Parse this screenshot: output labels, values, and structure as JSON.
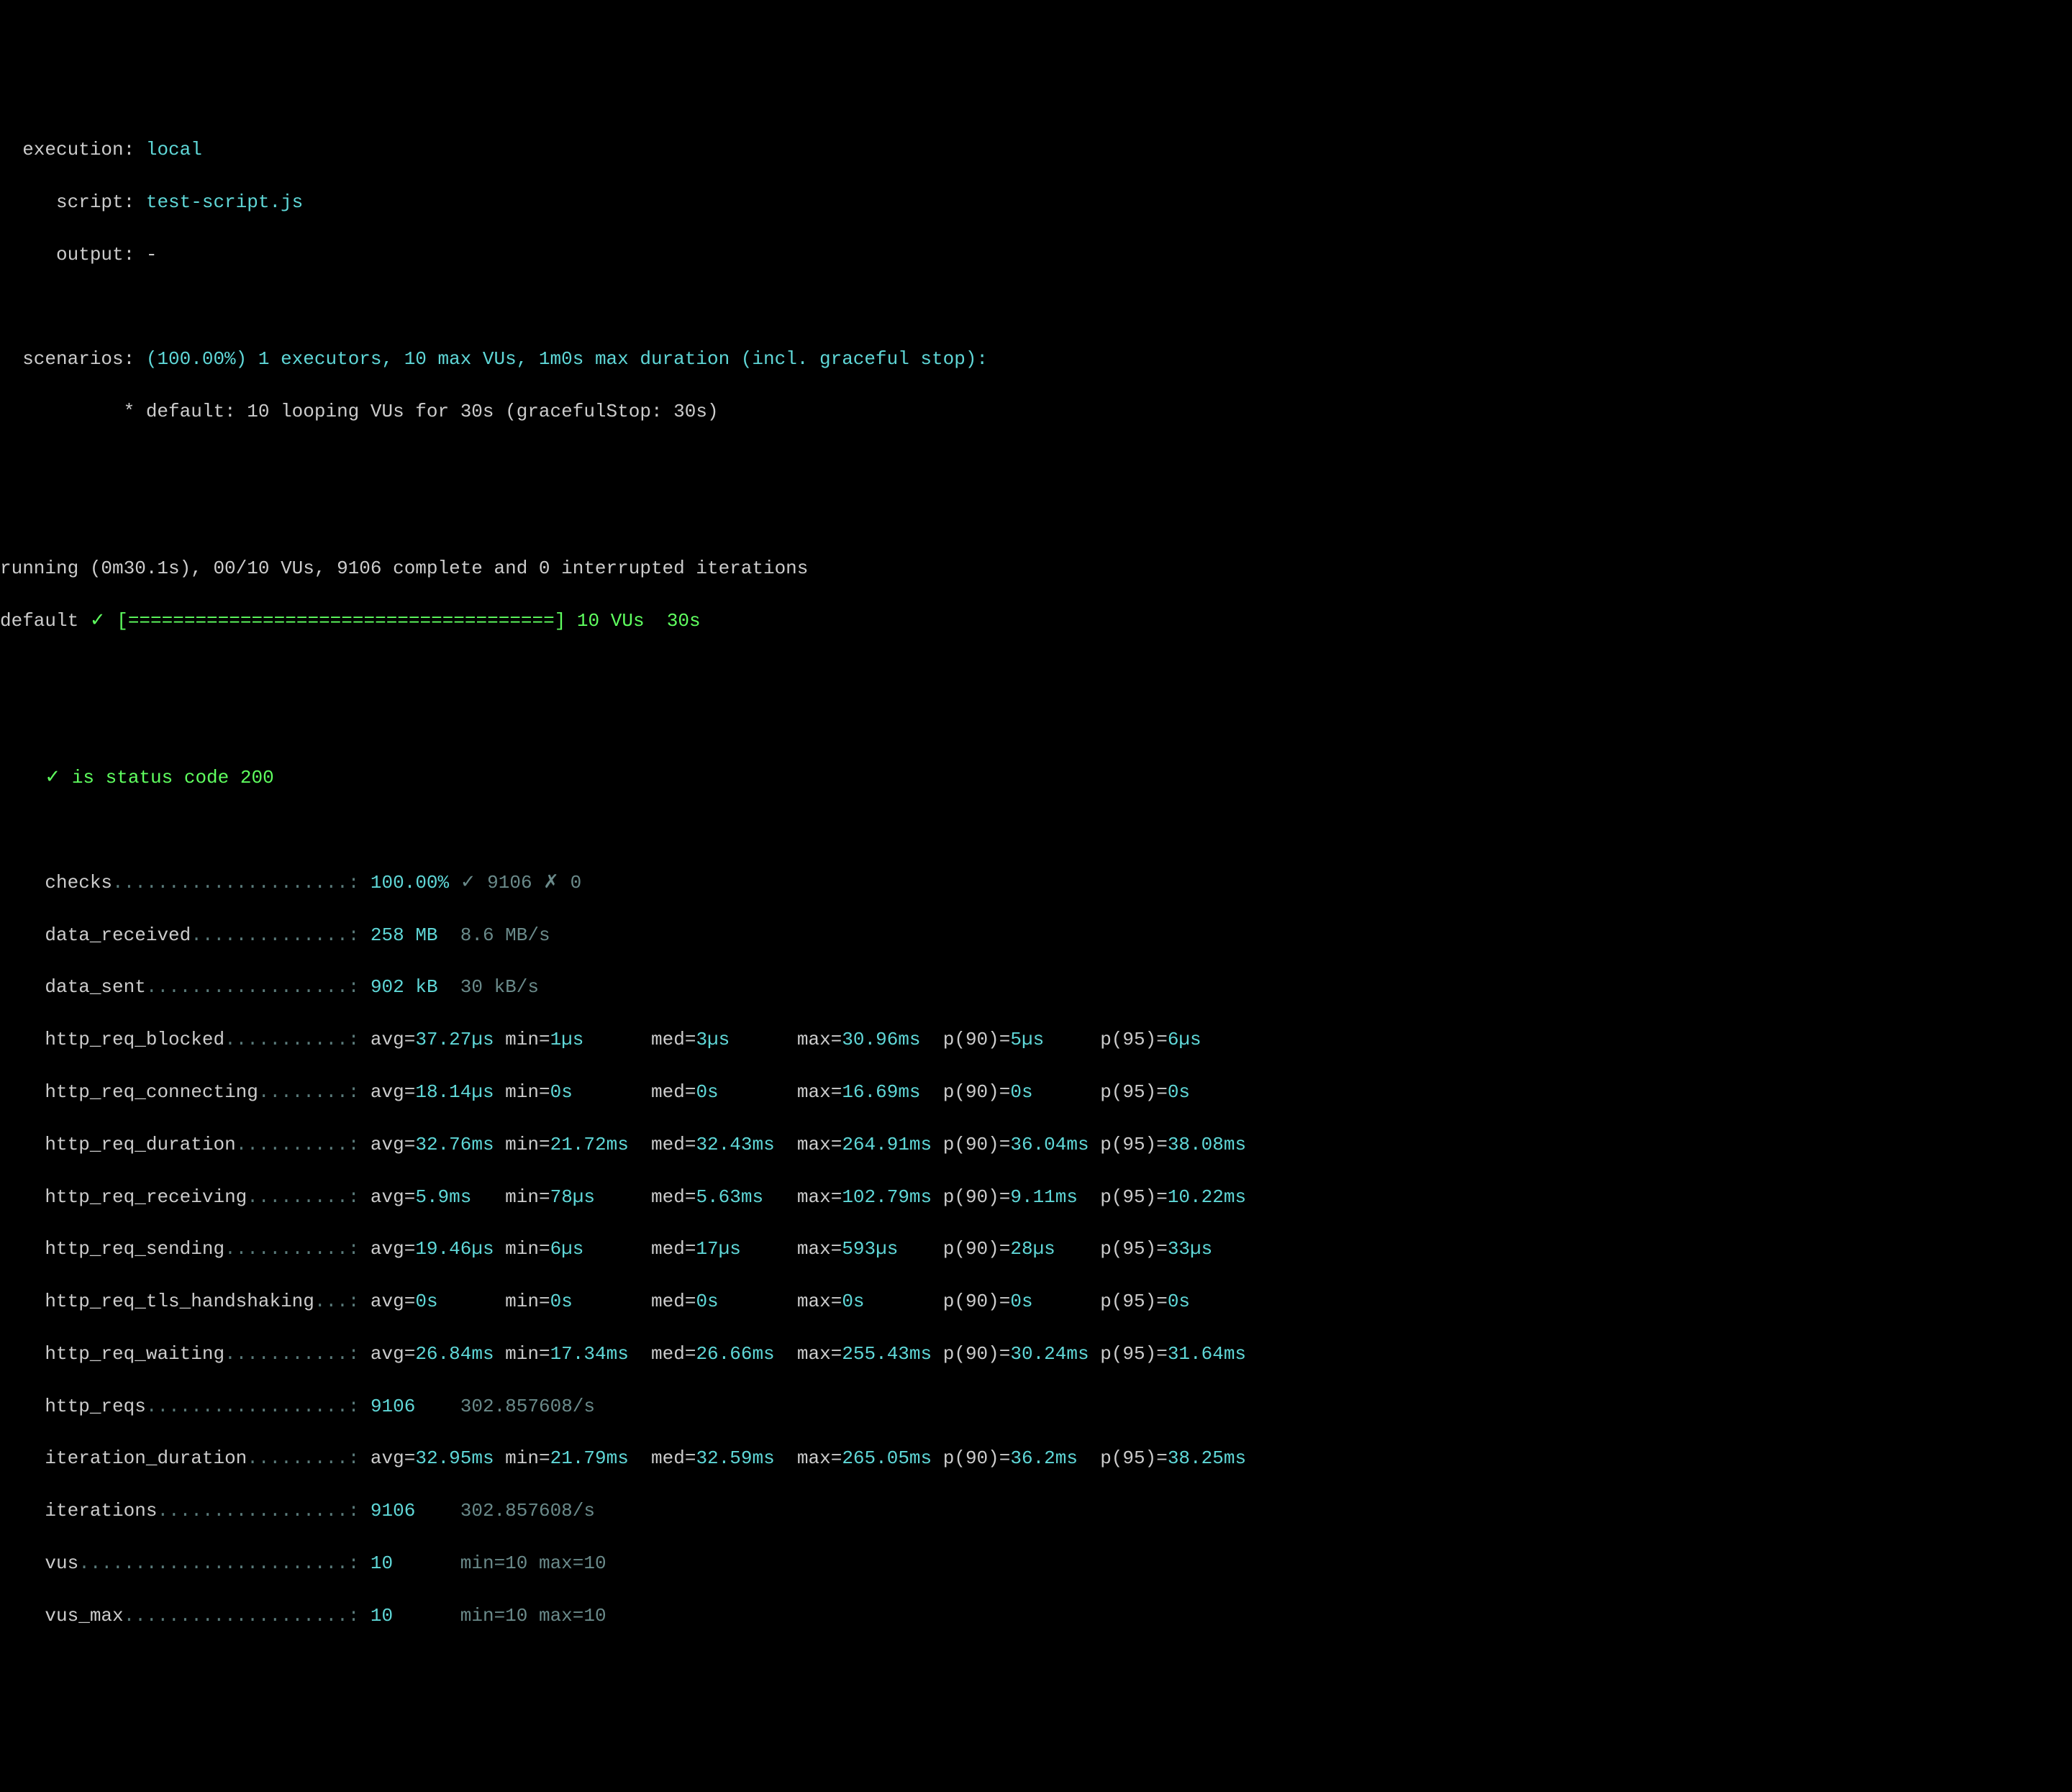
{
  "header": {
    "execution_label": "  execution: ",
    "execution_value": "local",
    "script_label": "     script: ",
    "script_value": "test-script.js",
    "output_label": "     output: ",
    "output_value": "-"
  },
  "scenarios": {
    "label": "  scenarios: ",
    "summary": "(100.00%) 1 executors, 10 max VUs, 1m0s max duration (incl. graceful stop):",
    "detail": "           * default: 10 looping VUs for 30s (gracefulStop: 30s)"
  },
  "running": {
    "line": "running (0m30.1s), 00/10 VUs, 9106 complete and 0 interrupted iterations",
    "default_prefix": "default ",
    "check_glyph": "✓",
    "bar": " [======================================] 10 VUs  30s"
  },
  "status_check": {
    "glyph": "✓",
    "text": " is status code 200"
  },
  "metrics": {
    "checks": {
      "name": "checks",
      "dots": ".....................",
      "value": "100.00%",
      "pass_glyph": "✓",
      "pass": " 9106 ",
      "fail_glyph": "✗",
      "fail": " 0"
    },
    "data_received": {
      "name": "data_received",
      "dots": "..............",
      "value": "258 MB",
      "rate": "  8.6 MB/s"
    },
    "data_sent": {
      "name": "data_sent",
      "dots": "..................",
      "value": "902 kB",
      "rate": "  30 kB/s"
    },
    "http_req_blocked": {
      "name": "http_req_blocked",
      "dots": "...........",
      "avg": "37.27µs",
      "min": "1µs",
      "med": "3µs",
      "max": "30.96ms",
      "p90": "5µs",
      "p95": "6µs"
    },
    "http_req_connecting": {
      "name": "http_req_connecting",
      "dots": "........",
      "avg": "18.14µs",
      "min": "0s",
      "med": "0s",
      "max": "16.69ms",
      "p90": "0s",
      "p95": "0s"
    },
    "http_req_duration": {
      "name": "http_req_duration",
      "dots": "..........",
      "avg": "32.76ms",
      "min": "21.72ms",
      "med": "32.43ms",
      "max": "264.91ms",
      "p90": "36.04ms",
      "p95": "38.08ms"
    },
    "http_req_receiving": {
      "name": "http_req_receiving",
      "dots": ".........",
      "avg": "5.9ms",
      "min": "78µs",
      "med": "5.63ms",
      "max": "102.79ms",
      "p90": "9.11ms",
      "p95": "10.22ms"
    },
    "http_req_sending": {
      "name": "http_req_sending",
      "dots": "...........",
      "avg": "19.46µs",
      "min": "6µs",
      "med": "17µs",
      "max": "593µs",
      "p90": "28µs",
      "p95": "33µs"
    },
    "http_req_tls_handshaking": {
      "name": "http_req_tls_handshaking",
      "dots": "...",
      "avg": "0s",
      "min": "0s",
      "med": "0s",
      "max": "0s",
      "p90": "0s",
      "p95": "0s"
    },
    "http_req_waiting": {
      "name": "http_req_waiting",
      "dots": "...........",
      "avg": "26.84ms",
      "min": "17.34ms",
      "med": "26.66ms",
      "max": "255.43ms",
      "p90": "30.24ms",
      "p95": "31.64ms"
    },
    "http_reqs": {
      "name": "http_reqs",
      "dots": "..................",
      "value": "9106",
      "rate": "    302.857608/s"
    },
    "iteration_duration": {
      "name": "iteration_duration",
      "dots": ".........",
      "avg": "32.95ms",
      "min": "21.79ms",
      "med": "32.59ms",
      "max": "265.05ms",
      "p90": "36.2ms",
      "p95": "38.25ms"
    },
    "iterations": {
      "name": "iterations",
      "dots": ".................",
      "value": "9106",
      "rate": "    302.857608/s"
    },
    "vus": {
      "name": "vus",
      "dots": "........................",
      "value": "10",
      "extra": "      min=10 max=10"
    },
    "vus_max": {
      "name": "vus_max",
      "dots": "....................",
      "value": "10",
      "extra": "      min=10 max=10"
    }
  },
  "labels": {
    "avg": "avg=",
    "min": "min=",
    "med": "med=",
    "max": "max=",
    "p90": "p(90)=",
    "p95": "p(95)="
  }
}
